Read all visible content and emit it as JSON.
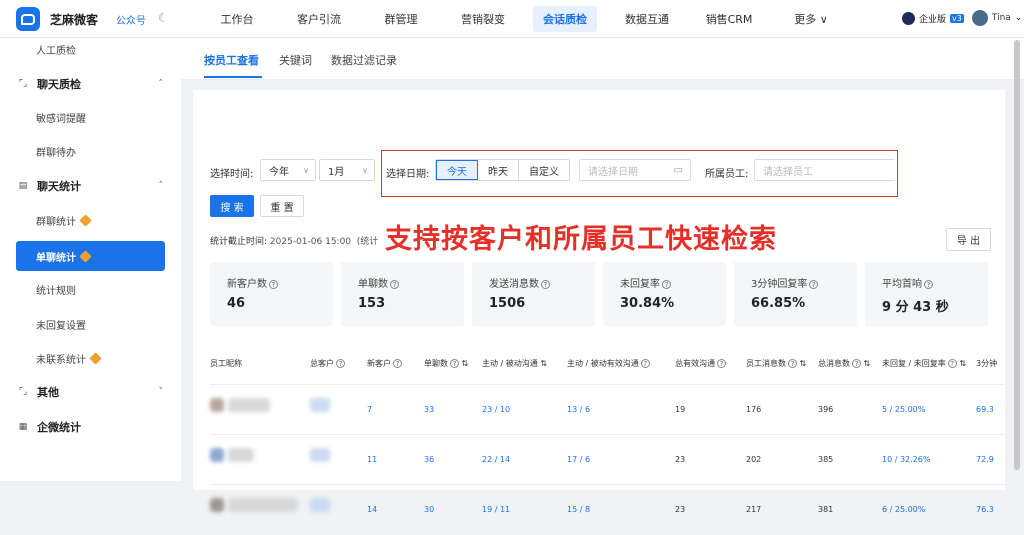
{
  "header": {
    "brand": "芝麻微客",
    "pub": "公众号",
    "moon_icon": "moon-icon",
    "nav": [
      "工作台",
      "客户引流",
      "群管理",
      "营销裂变",
      "会话质检",
      "数据互通",
      "销售CRM",
      "更多 ∨"
    ],
    "nav_active": 4,
    "ent_label": "企业版",
    "version": "v3",
    "user": "Tina"
  },
  "sidebar": {
    "items": [
      {
        "label": "人工质检",
        "type": "sub"
      },
      {
        "label": "聊天质检",
        "type": "group",
        "icon": "chat-check-icon",
        "chev": "˄"
      },
      {
        "label": "敏感词提醒",
        "type": "sub"
      },
      {
        "label": "群聊待办",
        "type": "sub"
      },
      {
        "label": "聊天统计",
        "type": "group",
        "icon": "chart-icon",
        "chev": "˄"
      },
      {
        "label": "群聊统计",
        "type": "sub",
        "vip": true
      },
      {
        "label": "单聊统计",
        "type": "active",
        "vip": true
      },
      {
        "label": "统计规则",
        "type": "sub"
      },
      {
        "label": "未回复设置",
        "type": "sub"
      },
      {
        "label": "未联系统计",
        "type": "sub",
        "vip": true
      },
      {
        "label": "其他",
        "type": "group",
        "icon": "other-icon",
        "chev": "˅"
      },
      {
        "label": "企微统计",
        "type": "group",
        "icon": "wework-icon",
        "chev": ""
      }
    ]
  },
  "tabs": [
    "按员工查看",
    "关键词",
    "数据过滤记录"
  ],
  "filter": {
    "time_label": "选择时间:",
    "year": "今年",
    "month": "1月",
    "date_label": "选择日期:",
    "seg": [
      "今天",
      "昨天",
      "自定义"
    ],
    "date_placeholder": "请选择日期",
    "emp_label": "所属员工:",
    "emp_placeholder": "请选择员工",
    "search": "搜 索",
    "reset": "重 置"
  },
  "deadline": {
    "label": "统计截止时间:",
    "value": "2025-01-06 15:00",
    "trail": "(统计"
  },
  "overlay": "支持按客户和所属员工快速检索",
  "export": "导 出",
  "stats": [
    {
      "title": "新客户数",
      "value": "46"
    },
    {
      "title": "单聊数",
      "value": "153"
    },
    {
      "title": "发送消息数",
      "value": "1506"
    },
    {
      "title": "未回复率",
      "value": "30.84%"
    },
    {
      "title": "3分钟回复率",
      "value": "66.85%"
    },
    {
      "title": "平均首响",
      "value": "9 分 43 秒"
    }
  ],
  "table": {
    "headers": [
      "员工昵称",
      "总客户",
      "新客户",
      "单聊数",
      "主动 / 被动沟通",
      "主动 / 被动有效沟通",
      "总有效沟通",
      "员工消息数",
      "总消息数",
      "未回复 / 未回复率",
      "3分钟"
    ],
    "rows": [
      [
        "7",
        "33",
        "23 / 10",
        "13 / 6",
        "19",
        "176",
        "396",
        "5 / 25.00%",
        "69.3"
      ],
      [
        "11",
        "36",
        "22 / 14",
        "17 / 6",
        "23",
        "202",
        "385",
        "10 / 32.26%",
        "72.9"
      ],
      [
        "14",
        "30",
        "19 / 11",
        "15 / 8",
        "23",
        "217",
        "381",
        "6 / 25.00%",
        "76.3"
      ]
    ]
  }
}
